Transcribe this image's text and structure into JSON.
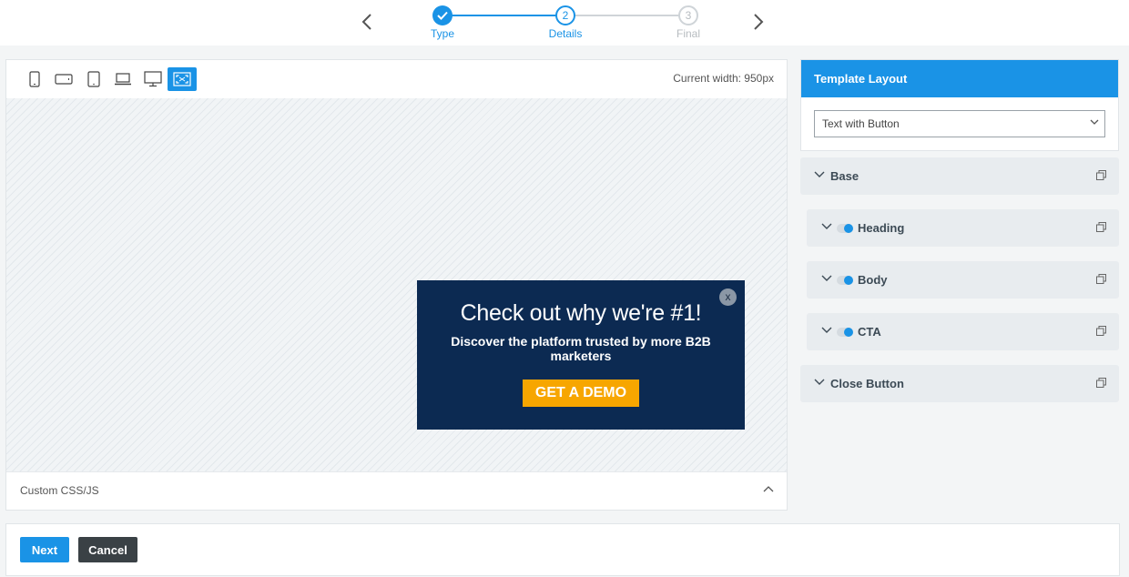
{
  "wizard": {
    "steps": [
      {
        "number": "",
        "label": "Type",
        "state": "complete"
      },
      {
        "number": "2",
        "label": "Details",
        "state": "current"
      },
      {
        "number": "3",
        "label": "Final",
        "state": "upcoming"
      }
    ],
    "prev_icon": "chevron-left-icon",
    "next_icon": "chevron-right-icon"
  },
  "preview": {
    "devices": [
      {
        "name": "mobile-portrait-icon",
        "active": false
      },
      {
        "name": "mobile-landscape-icon",
        "active": false
      },
      {
        "name": "tablet-icon",
        "active": false
      },
      {
        "name": "laptop-icon",
        "active": false
      },
      {
        "name": "desktop-icon",
        "active": false
      },
      {
        "name": "fullscreen-icon",
        "active": true
      }
    ],
    "width_readout": "Current width: 950px",
    "popup": {
      "close_label": "x",
      "heading": "Check out why we're #1!",
      "body": "Discover the platform trusted by more B2B marketers",
      "cta": "GET A DEMO",
      "background": "#0c2a52",
      "cta_color": "#f7a600"
    },
    "custom_css_label": "Custom CSS/JS"
  },
  "settings": {
    "template_layout_title": "Template Layout",
    "template_layout_value": "Text with Button",
    "sections": [
      {
        "label": "Base",
        "toggle": false,
        "nested": false
      },
      {
        "label": "Heading",
        "toggle": true,
        "nested": true
      },
      {
        "label": "Body",
        "toggle": true,
        "nested": true
      },
      {
        "label": "CTA",
        "toggle": true,
        "nested": true
      },
      {
        "label": "Close Button",
        "toggle": false,
        "nested": false
      }
    ]
  },
  "footer": {
    "next_label": "Next",
    "cancel_label": "Cancel"
  },
  "colors": {
    "accent": "#1a93e6",
    "dark_button": "#3a4145"
  }
}
